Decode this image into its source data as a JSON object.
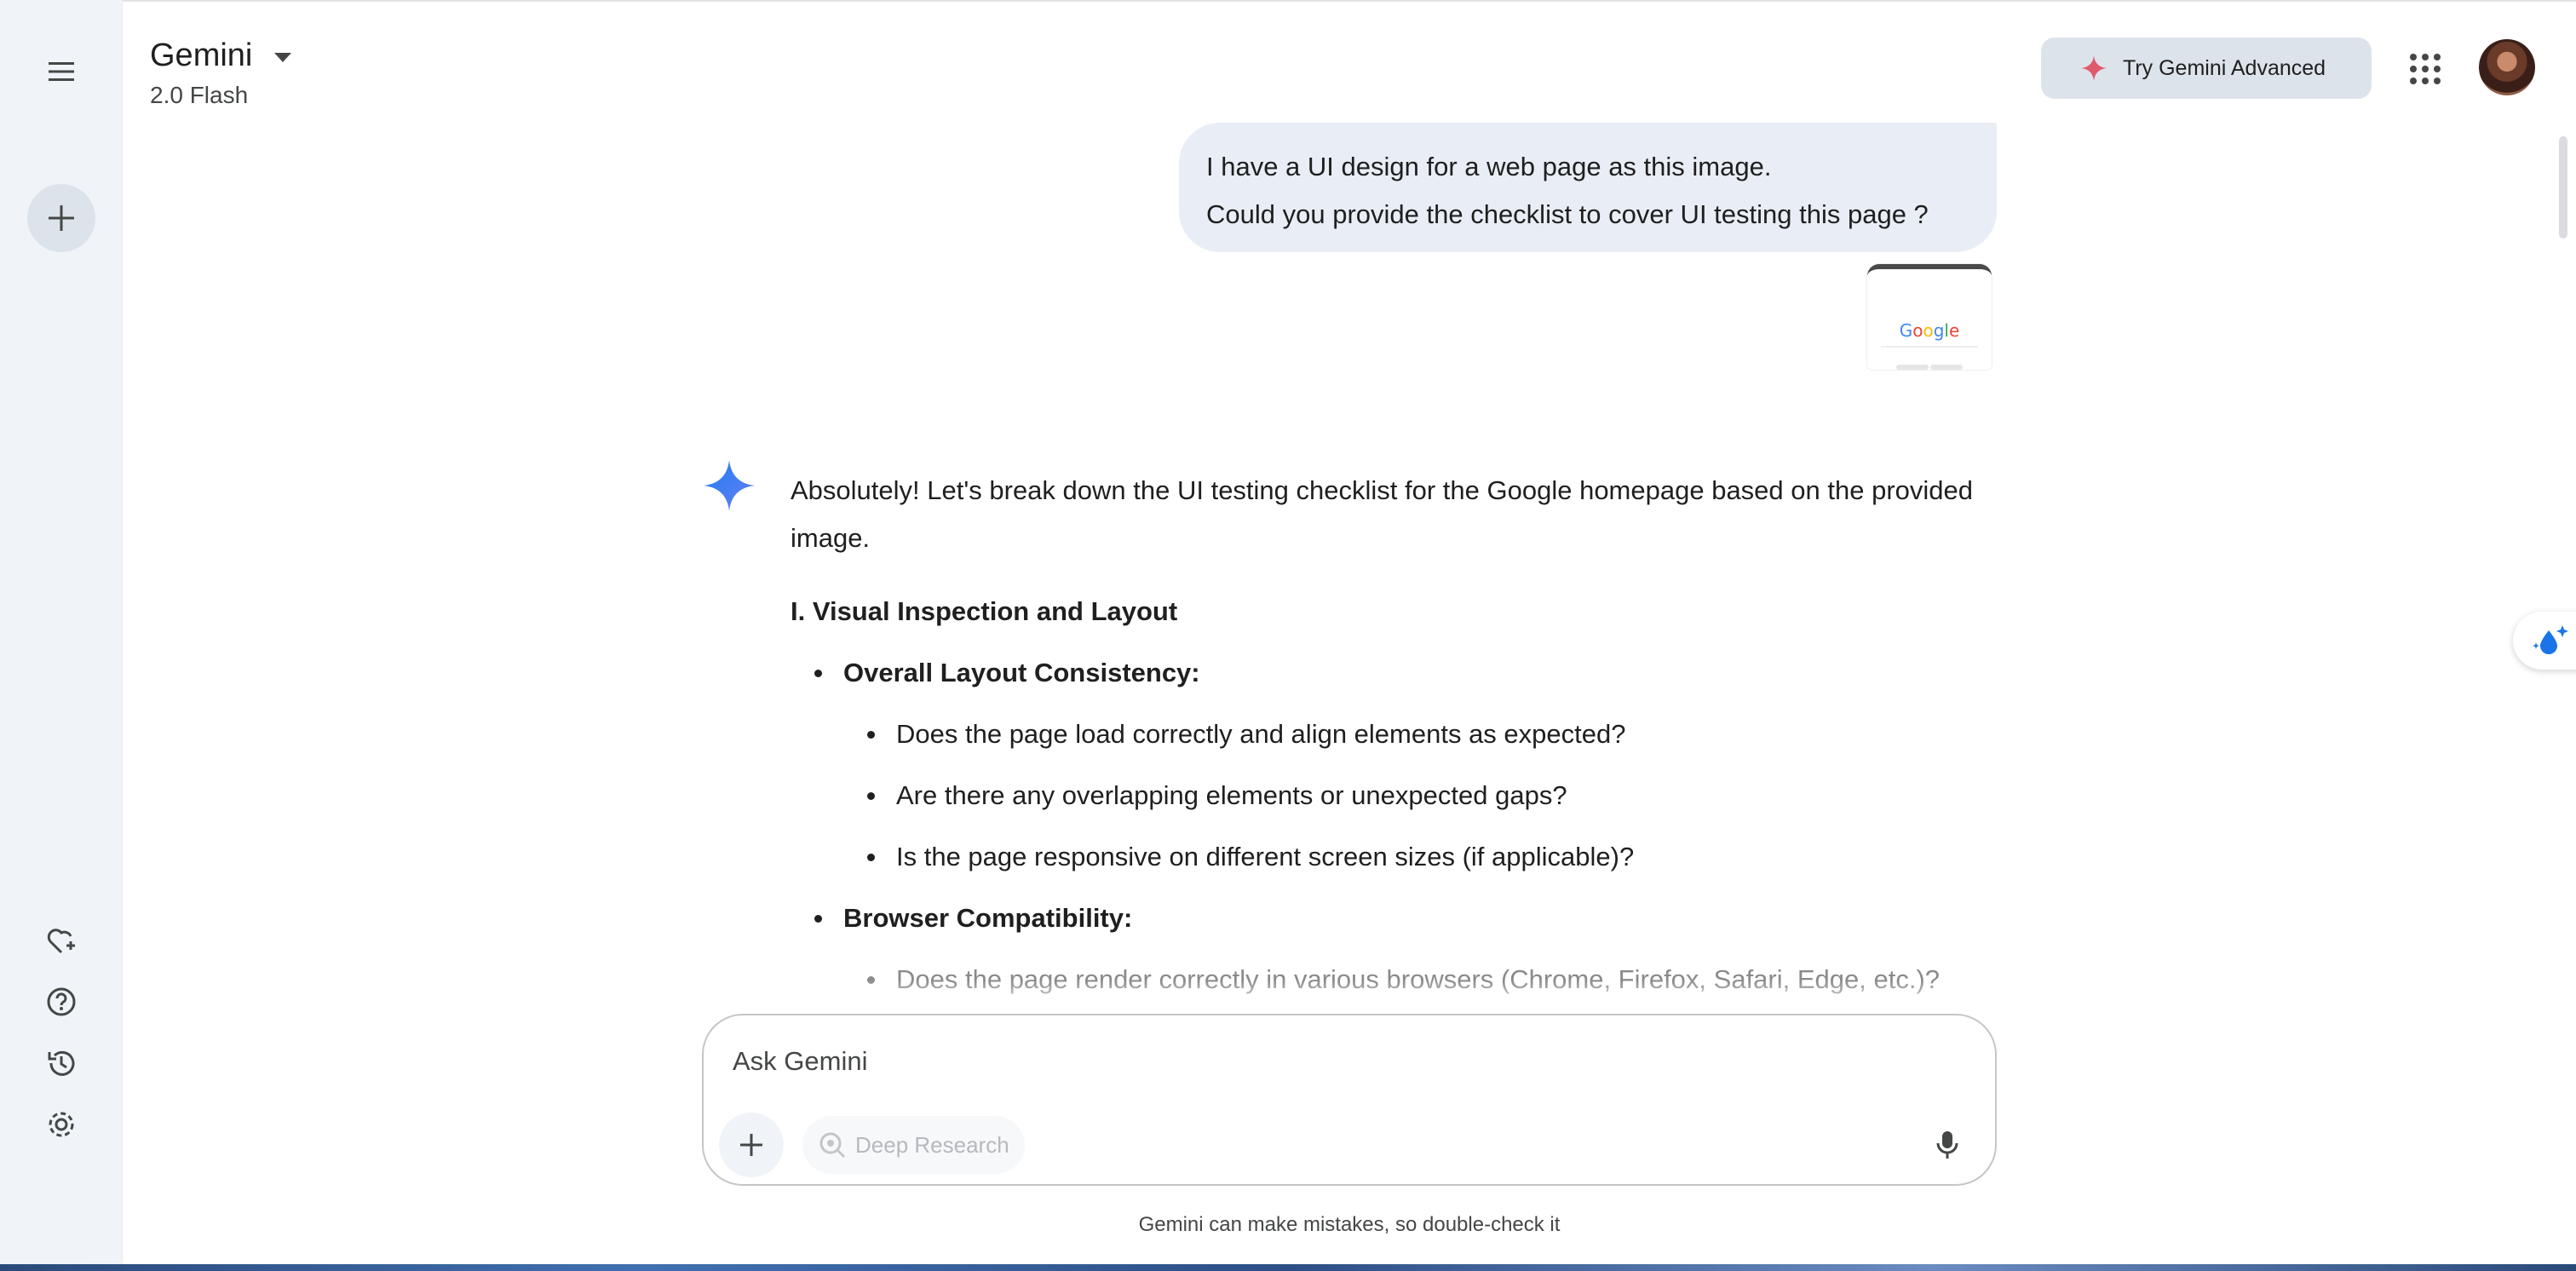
{
  "header": {
    "app_title": "Gemini",
    "model": "2.0 Flash",
    "advanced_button": "Try Gemini Advanced"
  },
  "sidebar": {
    "icons": [
      "menu-icon",
      "new-chat-icon",
      "gem-icon",
      "help-icon",
      "activity-icon",
      "settings-icon"
    ]
  },
  "conversation": {
    "user_message": {
      "line1": "I have a UI design for a web page as this image.",
      "line2": "Could you provide the checklist to cover UI testing this page ?",
      "attachment_logo": "Google"
    },
    "response": {
      "intro": "Absolutely! Let's break down the UI testing checklist for the Google homepage based on the provided image.",
      "section_title": "I. Visual Inspection and Layout",
      "items": [
        {
          "title": "Overall Layout Consistency:",
          "subitems": [
            "Does the page load correctly and align elements as expected?",
            "Are there any overlapping elements or unexpected gaps?",
            "Is the page responsive on different screen sizes (if applicable)?"
          ]
        },
        {
          "title": "Browser Compatibility:",
          "subitems": [
            "Does the page render correctly in various browsers (Chrome, Firefox, Safari, Edge, etc.)?"
          ]
        }
      ]
    }
  },
  "input": {
    "placeholder": "Ask Gemini",
    "deep_research": "Deep Research"
  },
  "footer": {
    "disclaimer": "Gemini can make mistakes, so double-check it"
  },
  "colors": {
    "sidebar_bg": "#f0f4f9",
    "bubble_bg": "#e9eef6",
    "button_bg": "#dde3ea",
    "gemini_blue": "#4285f4",
    "spark_red": "#e05a6d"
  }
}
